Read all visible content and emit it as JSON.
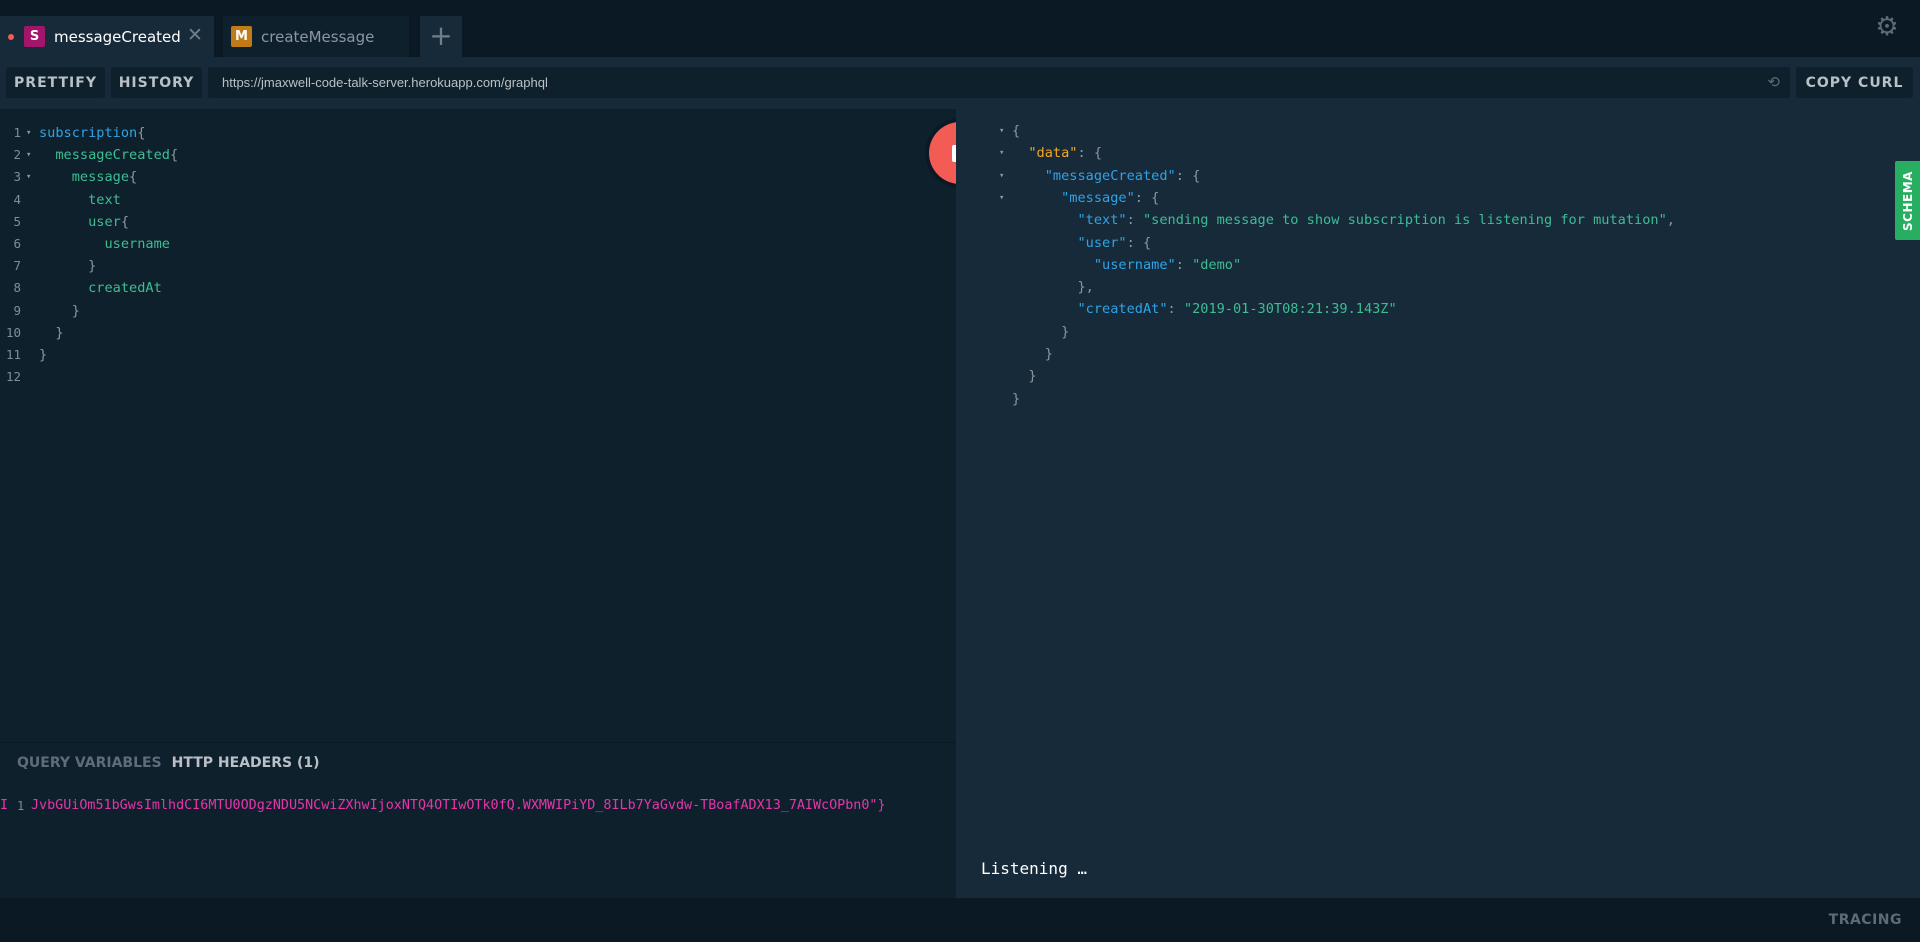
{
  "tabs": [
    {
      "badge": "S",
      "badge_color": "#a3156b",
      "name": "messageCreated",
      "close": "✕",
      "has_unsaved_dot": true
    },
    {
      "badge": "M",
      "badge_color": "#c07b17",
      "name": "createMessage"
    }
  ],
  "new_tab_icon": "+",
  "settings_icon": "⚙",
  "toolbar": {
    "prettify_label": "PRETTIFY",
    "history_label": "HISTORY",
    "endpoint_url": "https://jmaxwell-code-talk-server.herokuapp.com/graphql",
    "reload_icon": "⟲",
    "copy_curl_label": "COPY CURL"
  },
  "editor": {
    "lines": [
      {
        "num": "1",
        "fold": "▾",
        "code": "subscription{"
      },
      {
        "num": "2",
        "fold": "▾",
        "code": "  messageCreated{"
      },
      {
        "num": "3",
        "fold": "▾",
        "code": "    message{"
      },
      {
        "num": "4",
        "fold": "",
        "code": "      text"
      },
      {
        "num": "5",
        "fold": "",
        "code": "      user{"
      },
      {
        "num": "6",
        "fold": "",
        "code": "        username"
      },
      {
        "num": "7",
        "fold": "",
        "code": "      }"
      },
      {
        "num": "8",
        "fold": "",
        "code": "      createdAt"
      },
      {
        "num": "9",
        "fold": "",
        "code": "    }"
      },
      {
        "num": "10",
        "fold": "",
        "code": "  }"
      },
      {
        "num": "11",
        "fold": "",
        "code": "}"
      },
      {
        "num": "12",
        "fold": "",
        "code": ""
      }
    ]
  },
  "variables_pane": {
    "tab_query_variables": "QUERY VARIABLES",
    "tab_http_headers": "HTTP HEADERS (1)",
    "header_line_num": "1",
    "header_left_edge": "I",
    "header_content": "JvbGUiOm51bGwsImlhdCI6MTU0ODgzNDU5NCwiZXhwIjoxNTQ4OTIwOTk0fQ.WXMWIPiYD_8ILb7YaGvdw-TBoafADX13_7AIWcOPbn0\"}"
  },
  "result": {
    "lines": [
      {
        "fold": "▾",
        "text": "{"
      },
      {
        "fold": "▾",
        "text": "  \"data\": {"
      },
      {
        "fold": "▾",
        "text": "    \"messageCreated\": {"
      },
      {
        "fold": "▾",
        "text": "      \"message\": {"
      },
      {
        "fold": "",
        "text": "        \"text\": \"sending message to show subscription is listening for mutation\","
      },
      {
        "fold": "",
        "text": "        \"user\": {"
      },
      {
        "fold": "",
        "text": "          \"username\": \"demo\""
      },
      {
        "fold": "",
        "text": "        },"
      },
      {
        "fold": "",
        "text": "        \"createdAt\": \"2019-01-30T08:21:39.143Z\""
      },
      {
        "fold": "",
        "text": "      }"
      },
      {
        "fold": "",
        "text": "    }"
      },
      {
        "fold": "",
        "text": "  }"
      },
      {
        "fold": "",
        "text": "}"
      }
    ],
    "status": "Listening …"
  },
  "schema_label": "SCHEMA",
  "footer": {
    "tracing_label": "TRACING"
  },
  "colors": {
    "background": "#0b1924",
    "editor_bg": "#0f202d",
    "result_bg": "#172a3a",
    "keyword": "#2fa3e6",
    "field": "#3ebd93",
    "root_key": "#f7a81b",
    "header_string": "#e535ab",
    "run_button": "#f25c54",
    "schema_tab": "#27ae60"
  }
}
